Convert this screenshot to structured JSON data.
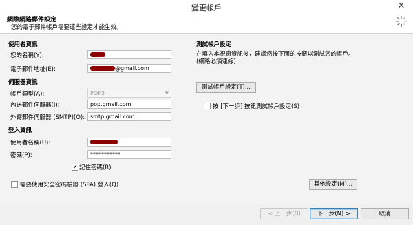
{
  "window": {
    "title": "變更帳戶"
  },
  "header": {
    "title": "網際網路郵件設定",
    "subtitle": "您的電子郵件帳戶需要這些設定才能生效。"
  },
  "user_info": {
    "section": "使用者資訊",
    "name_label": "您的名稱(Y):",
    "email_label": "電子郵件地址(E):",
    "email_suffix": "@gmail.com"
  },
  "server_info": {
    "section": "伺服器資訊",
    "account_type_label": "帳戶類型(A):",
    "account_type_value": "POP3",
    "incoming_label": "內送郵件伺服器(I):",
    "incoming_value": "pop.gmail.com",
    "outgoing_label": "外寄郵件伺服器 (SMTP)(O):",
    "outgoing_value": "smtp.gmail.com"
  },
  "login_info": {
    "section": "登入資訊",
    "username_label": "使用者名稱(U):",
    "password_label": "密碼(P):",
    "password_value": "***********",
    "remember_label": "記住密碼(R)",
    "remember_checked": true,
    "spa_label": "需要使用安全密碼驗證 (SPA) 登入(Q)",
    "spa_checked": false
  },
  "test": {
    "section": "測試帳戶設定",
    "description": "在填入本視窗資訊後，建議您按下面的按鈕以測試您的帳戶。(網路必須連線)",
    "test_button": "測試帳戶設定(T)...",
    "next_test_label": "按 [下一步] 按鈕測試帳戶設定(S)",
    "next_test_checked": false
  },
  "more_settings_button": "其他設定(M)...",
  "footer": {
    "back": "< 上一步(B)",
    "next": "下一步(N) >",
    "cancel": "取消"
  }
}
